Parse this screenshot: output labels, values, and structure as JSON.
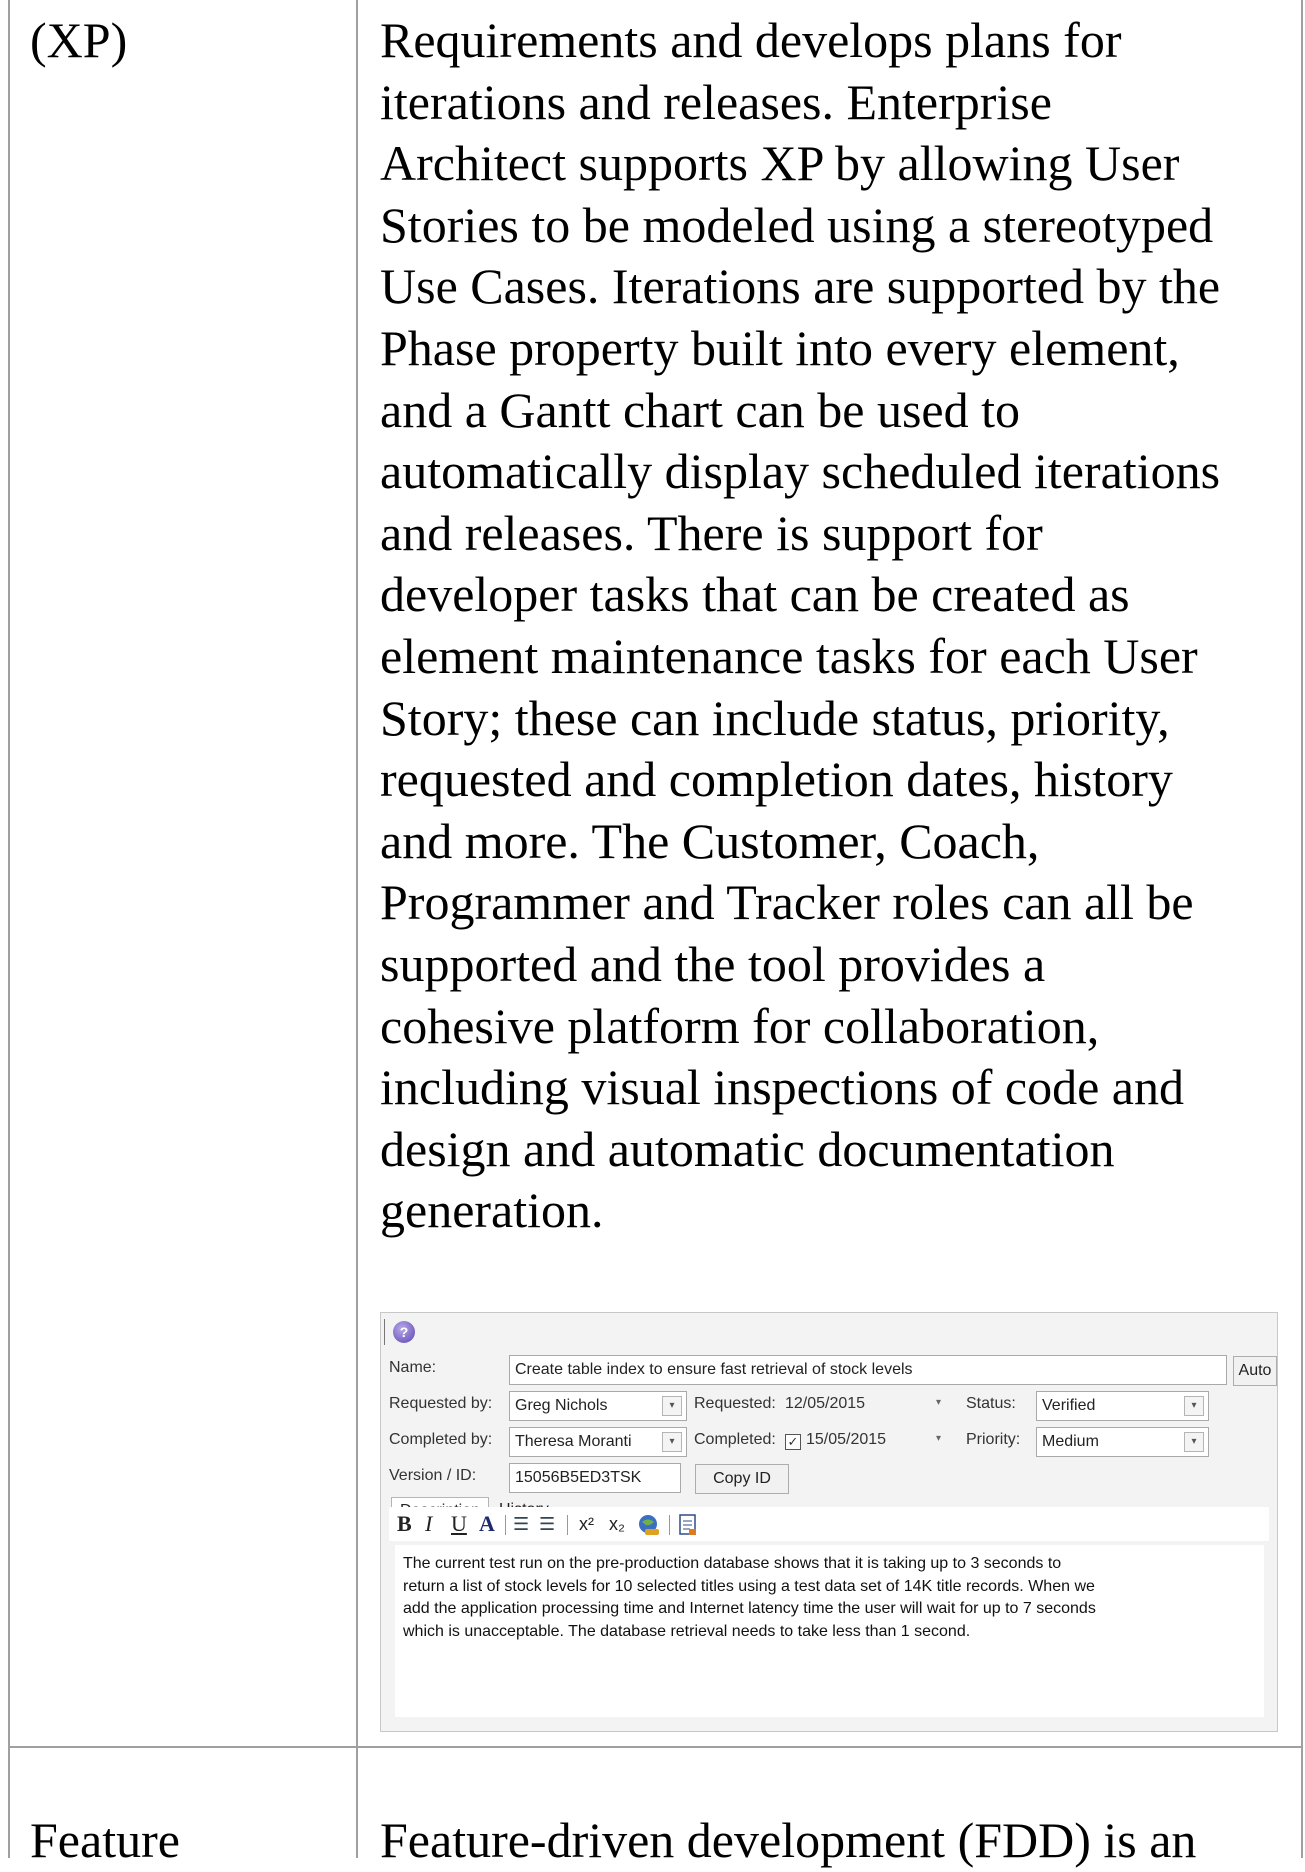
{
  "row1": {
    "label": "(XP)",
    "paragraph_lines": [
      "Requirements and develops plans for",
      "iterations and releases. Enterprise",
      "Architect supports XP by allowing User",
      "Stories to be modeled using a stereotyped",
      "Use Cases. Iterations are supported by the",
      "Phase property built into every element,",
      "and a Gantt chart can be used to",
      "automatically display scheduled iterations",
      "and releases. There is support for",
      "developer tasks that can be created as",
      "element maintenance tasks for each User",
      "Story; these can include status, priority,",
      "requested and completion dates, history",
      "and more. The Customer, Coach,",
      "Programmer and Tracker roles can all be",
      "supported and the tool provides a",
      "cohesive platform for collaboration,",
      "including visual inspections of code and",
      "design and automatic documentation",
      "generation."
    ]
  },
  "dialog": {
    "help_icon": "help-icon",
    "name_label": "Name:",
    "name_value": "Create table index to ensure fast retrieval of stock levels",
    "auto_button": "Auto",
    "requested_by_label": "Requested by:",
    "requested_by_value": "Greg Nichols",
    "requested_label": "Requested:",
    "requested_value": "12/05/2015",
    "status_label": "Status:",
    "status_value": "Verified",
    "completed_by_label": "Completed by:",
    "completed_by_value": "Theresa Moranti",
    "completed_label": "Completed:",
    "completed_checked": "✓",
    "completed_value": "15/05/2015",
    "priority_label": "Priority:",
    "priority_value": "Medium",
    "version_label": "Version / ID:",
    "version_value": "15056B5ED3TSK",
    "copy_id_button": "Copy ID",
    "tabs": [
      "Description",
      "History"
    ],
    "toolbar": {
      "bold": "B",
      "italic": "I",
      "underline": "U",
      "font_color": "A",
      "bullets": "☰",
      "numbering": "☰",
      "superscript": "x²",
      "subscript": "x₂",
      "hyperlink_icon": "hyperlink-icon",
      "document_icon": "document-icon"
    },
    "description_lines": [
      "The current test run on the pre-production database shows that it is taking up to 3 seconds to",
      "return a list of stock levels for 10 selected titles using a test data set of 14K title records. When we",
      "add the application processing time and Internet latency time the user will wait for up to 7 seconds",
      "which is unacceptable. The database retrieval needs to take less than 1 second."
    ]
  },
  "row2": {
    "label": "Feature",
    "paragraph_first_line": "Feature-driven development (FDD) is an"
  }
}
